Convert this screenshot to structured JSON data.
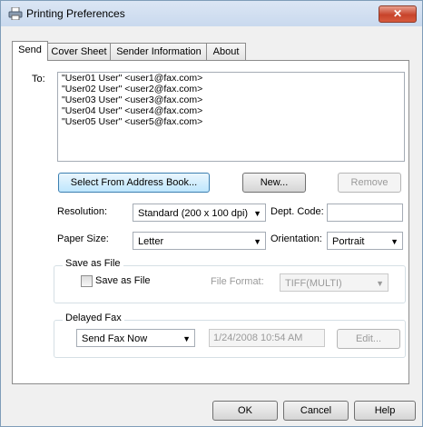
{
  "window": {
    "title": "Printing Preferences",
    "close_label": "✕"
  },
  "tabs": [
    {
      "label": "Send"
    },
    {
      "label": "Cover Sheet"
    },
    {
      "label": "Sender Information"
    },
    {
      "label": "About"
    }
  ],
  "recipients": {
    "label": "To:",
    "items": [
      "\"User01 User\" <user1@fax.com>",
      "\"User02 User\" <user2@fax.com>",
      "\"User03 User\" <user3@fax.com>",
      "\"User04 User\" <user4@fax.com>",
      "\"User05 User\" <user5@fax.com>"
    ]
  },
  "buttons": {
    "select_address_book": "Select From Address Book...",
    "new": "New...",
    "remove": "Remove",
    "ok": "OK",
    "cancel": "Cancel",
    "help": "Help",
    "edit": "Edit..."
  },
  "fields": {
    "resolution_label": "Resolution:",
    "resolution_value": "Standard (200 x 100 dpi)",
    "dept_code_label": "Dept. Code:",
    "dept_code_value": "",
    "paper_size_label": "Paper Size:",
    "paper_size_value": "Letter",
    "orientation_label": "Orientation:",
    "orientation_value": "Portrait"
  },
  "save_as_file": {
    "group_title": "Save as File",
    "checkbox_label": "Save as File",
    "checked": false,
    "file_format_label": "File Format:",
    "file_format_value": "TIFF(MULTI)"
  },
  "delayed_fax": {
    "group_title": "Delayed Fax",
    "mode_value": "Send Fax Now",
    "datetime_value": "1/24/2008 10:54 AM"
  },
  "icons": {
    "title": "printer-icon",
    "dropdown": "chevron-down-icon"
  }
}
